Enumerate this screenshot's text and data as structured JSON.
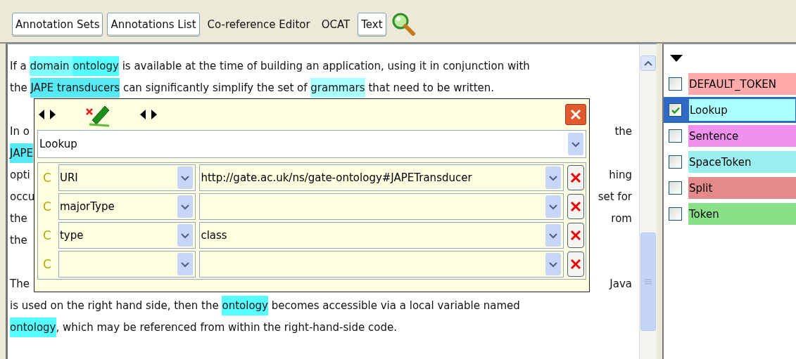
{
  "toolbar": {
    "buttons": [
      {
        "label": "Annotation Sets",
        "selected": true
      },
      {
        "label": "Annotations List",
        "selected": true
      },
      {
        "label": "Co-reference Editor",
        "selected": false
      },
      {
        "label": "OCAT",
        "selected": false
      },
      {
        "label": "Text",
        "selected": true
      }
    ]
  },
  "document": {
    "paragraphs": [
      {
        "lines": [
          {
            "segments": [
              {
                "text": "If a "
              },
              {
                "text": "domain ",
                "color": "#80ffff"
              },
              {
                "text": "ontology",
                "color": "#55ffff"
              },
              {
                "text": " is available at the time of building an application, using it in conjunction with"
              }
            ]
          },
          {
            "segments": [
              {
                "text": "the "
              },
              {
                "text": "JAPE transducers",
                "color": "#55eaf5"
              },
              {
                "text": " can significantly simplify the set of "
              },
              {
                "text": "grammars",
                "color": "#aaffff"
              },
              {
                "text": " that need to be written."
              }
            ]
          }
        ]
      },
      {
        "lines": [
          {
            "segments": [
              {
                "text": "In o"
              }
            ],
            "tail": "the"
          },
          {
            "segments": [
              {
                "text": "JAPE",
                "color": "#55eaf5"
              }
            ]
          },
          {
            "segments": [
              {
                "text": "opti"
              }
            ],
            "tail": "hing"
          },
          {
            "segments": [
              {
                "text": "occu"
              }
            ],
            "tail": "set for"
          },
          {
            "segments": [
              {
                "text": "the"
              }
            ],
            "tail": "rom"
          },
          {
            "segments": [
              {
                "text": "the"
              }
            ]
          }
        ]
      },
      {
        "lines": [
          {
            "segments": [
              {
                "text": "The"
              }
            ],
            "tail": "Java"
          },
          {
            "segments": [
              {
                "text": "is used on the right hand side, then the "
              },
              {
                "text": "ontology",
                "color": "#55ffff"
              },
              {
                "text": " becomes accessible via a local variable named"
              }
            ]
          },
          {
            "segments": [
              {
                "text": "ontology",
                "color": "#55ffff"
              },
              {
                "text": ", which may be referenced from within the right-hand-side code."
              }
            ]
          }
        ]
      }
    ]
  },
  "annotation_editor": {
    "type": "Lookup",
    "features": [
      {
        "marker": "C",
        "name": "URI",
        "value": "http://gate.ac.uk/ns/gate-ontology#JAPETransducer"
      },
      {
        "marker": "C",
        "name": "majorType"
      },
      {
        "marker": "C",
        "name": "type",
        "value": "class"
      },
      {
        "marker": "C"
      }
    ]
  },
  "annotation_types": [
    {
      "label": "DEFAULT_TOKEN",
      "color": "#ffaaaa",
      "checked": false,
      "selected": false
    },
    {
      "label": "Lookup",
      "color": "#aaffff",
      "checked": true,
      "selected": true
    },
    {
      "label": "Sentence",
      "color": "#ee90ee",
      "checked": false,
      "selected": false
    },
    {
      "label": "SpaceToken",
      "color": "#99eeee",
      "checked": false,
      "selected": false
    },
    {
      "label": "Split",
      "color": "#e38a8a",
      "checked": false,
      "selected": false
    },
    {
      "label": "Token",
      "color": "#88e088",
      "checked": false,
      "selected": false
    }
  ]
}
